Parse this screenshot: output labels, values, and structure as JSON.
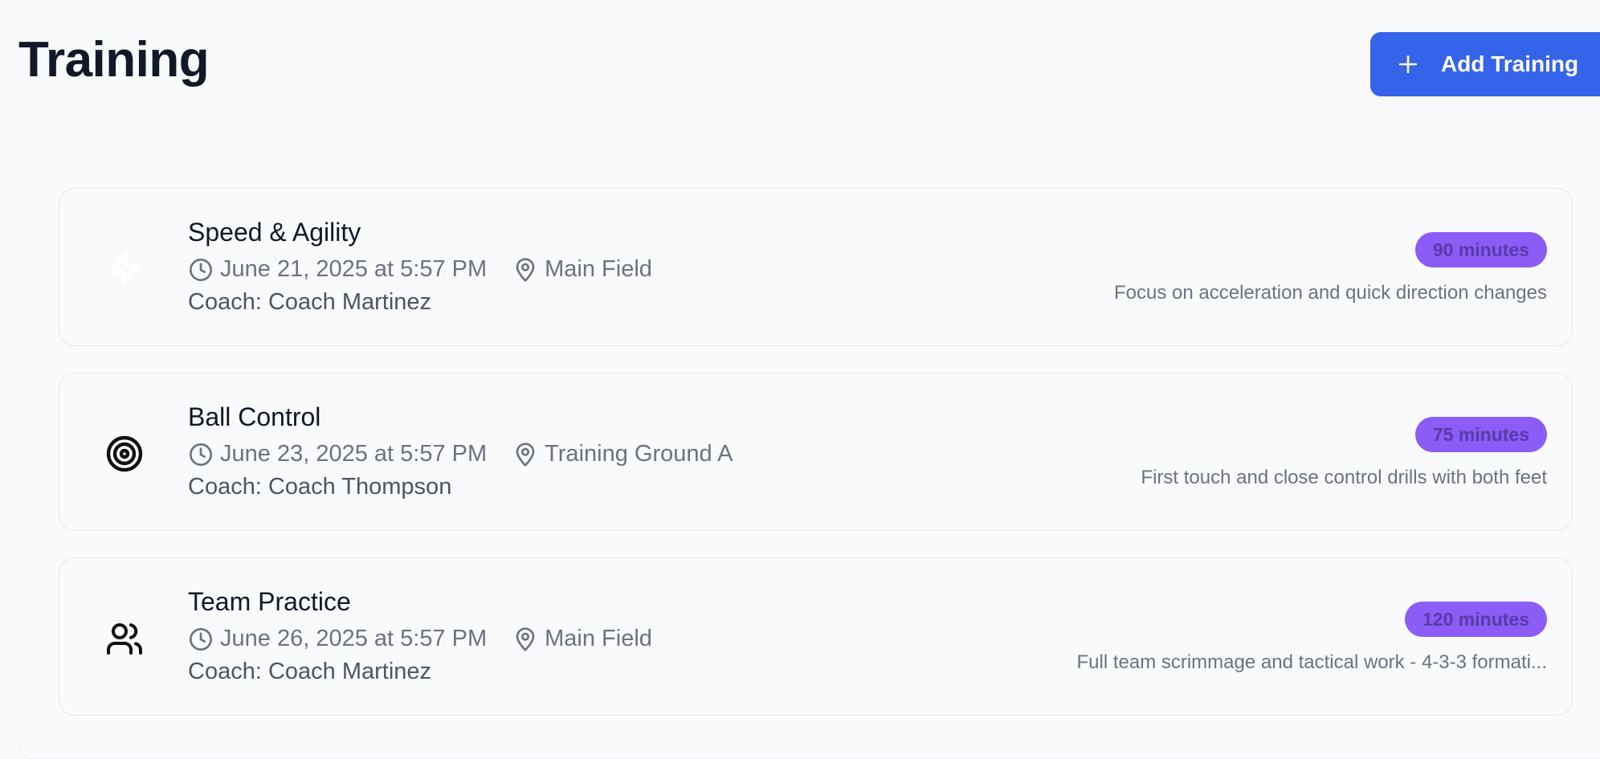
{
  "header": {
    "title": "Training",
    "add_button_label": "Add Training"
  },
  "colors": {
    "accent": "#3563e9",
    "badge": "#8b5cf6"
  },
  "sessions": [
    {
      "icon": "bolt-icon",
      "title": "Speed & Agility",
      "datetime": "June 21, 2025 at 5:57 PM",
      "location": "Main Field",
      "coach": "Coach: Coach Martinez",
      "duration": "90 minutes",
      "description": "Focus on acceleration and quick direction changes"
    },
    {
      "icon": "target-icon",
      "title": "Ball Control",
      "datetime": "June 23, 2025 at 5:57 PM",
      "location": "Training Ground A",
      "coach": "Coach: Coach Thompson",
      "duration": "75 minutes",
      "description": "First touch and close control drills with both feet"
    },
    {
      "icon": "users-icon",
      "title": "Team Practice",
      "datetime": "June 26, 2025 at 5:57 PM",
      "location": "Main Field",
      "coach": "Coach: Coach Martinez",
      "duration": "120 minutes",
      "description": "Full team scrimmage and tactical work - 4-3-3 formati..."
    }
  ]
}
